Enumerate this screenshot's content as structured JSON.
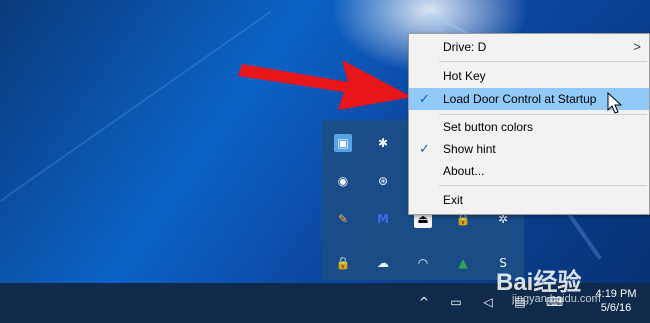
{
  "context_menu": {
    "items": [
      {
        "label": "Drive: D",
        "submenu": ">"
      },
      {
        "label": "Hot Key"
      },
      {
        "label": "Load Door Control at Startup",
        "checked": true,
        "checkmark": "✓"
      },
      {
        "label": "Set button colors"
      },
      {
        "label": "Show hint",
        "checked": true,
        "checkmark": "✓"
      },
      {
        "label": "About..."
      },
      {
        "label": "Exit"
      }
    ]
  },
  "taskbar": {
    "time": "4:19 PM",
    "date": "5/6/16"
  },
  "watermark": {
    "brand": "Bai经验",
    "url": "jingyan.baidu.com"
  },
  "colors": {
    "menu_highlight": "#91c9f7",
    "arrow": "#e8151b",
    "taskbar": "#0f2a4a",
    "tray_panel": "#1b4e86"
  }
}
